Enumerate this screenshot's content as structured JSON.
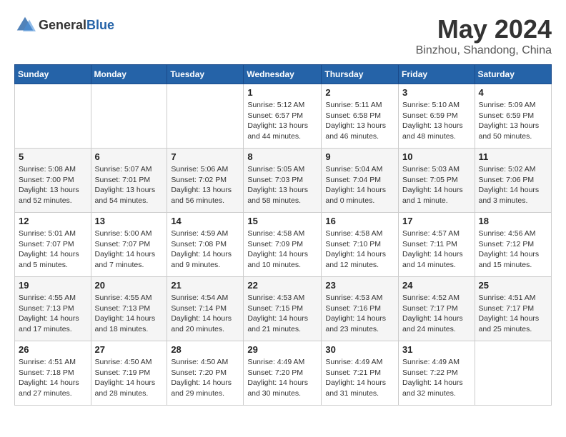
{
  "header": {
    "logo_general": "General",
    "logo_blue": "Blue",
    "month": "May 2024",
    "location": "Binzhou, Shandong, China"
  },
  "days_of_week": [
    "Sunday",
    "Monday",
    "Tuesday",
    "Wednesday",
    "Thursday",
    "Friday",
    "Saturday"
  ],
  "weeks": [
    [
      {
        "day": "",
        "content": ""
      },
      {
        "day": "",
        "content": ""
      },
      {
        "day": "",
        "content": ""
      },
      {
        "day": "1",
        "content": "Sunrise: 5:12 AM\nSunset: 6:57 PM\nDaylight: 13 hours\nand 44 minutes."
      },
      {
        "day": "2",
        "content": "Sunrise: 5:11 AM\nSunset: 6:58 PM\nDaylight: 13 hours\nand 46 minutes."
      },
      {
        "day": "3",
        "content": "Sunrise: 5:10 AM\nSunset: 6:59 PM\nDaylight: 13 hours\nand 48 minutes."
      },
      {
        "day": "4",
        "content": "Sunrise: 5:09 AM\nSunset: 6:59 PM\nDaylight: 13 hours\nand 50 minutes."
      }
    ],
    [
      {
        "day": "5",
        "content": "Sunrise: 5:08 AM\nSunset: 7:00 PM\nDaylight: 13 hours\nand 52 minutes."
      },
      {
        "day": "6",
        "content": "Sunrise: 5:07 AM\nSunset: 7:01 PM\nDaylight: 13 hours\nand 54 minutes."
      },
      {
        "day": "7",
        "content": "Sunrise: 5:06 AM\nSunset: 7:02 PM\nDaylight: 13 hours\nand 56 minutes."
      },
      {
        "day": "8",
        "content": "Sunrise: 5:05 AM\nSunset: 7:03 PM\nDaylight: 13 hours\nand 58 minutes."
      },
      {
        "day": "9",
        "content": "Sunrise: 5:04 AM\nSunset: 7:04 PM\nDaylight: 14 hours\nand 0 minutes."
      },
      {
        "day": "10",
        "content": "Sunrise: 5:03 AM\nSunset: 7:05 PM\nDaylight: 14 hours\nand 1 minute."
      },
      {
        "day": "11",
        "content": "Sunrise: 5:02 AM\nSunset: 7:06 PM\nDaylight: 14 hours\nand 3 minutes."
      }
    ],
    [
      {
        "day": "12",
        "content": "Sunrise: 5:01 AM\nSunset: 7:07 PM\nDaylight: 14 hours\nand 5 minutes."
      },
      {
        "day": "13",
        "content": "Sunrise: 5:00 AM\nSunset: 7:07 PM\nDaylight: 14 hours\nand 7 minutes."
      },
      {
        "day": "14",
        "content": "Sunrise: 4:59 AM\nSunset: 7:08 PM\nDaylight: 14 hours\nand 9 minutes."
      },
      {
        "day": "15",
        "content": "Sunrise: 4:58 AM\nSunset: 7:09 PM\nDaylight: 14 hours\nand 10 minutes."
      },
      {
        "day": "16",
        "content": "Sunrise: 4:58 AM\nSunset: 7:10 PM\nDaylight: 14 hours\nand 12 minutes."
      },
      {
        "day": "17",
        "content": "Sunrise: 4:57 AM\nSunset: 7:11 PM\nDaylight: 14 hours\nand 14 minutes."
      },
      {
        "day": "18",
        "content": "Sunrise: 4:56 AM\nSunset: 7:12 PM\nDaylight: 14 hours\nand 15 minutes."
      }
    ],
    [
      {
        "day": "19",
        "content": "Sunrise: 4:55 AM\nSunset: 7:13 PM\nDaylight: 14 hours\nand 17 minutes."
      },
      {
        "day": "20",
        "content": "Sunrise: 4:55 AM\nSunset: 7:13 PM\nDaylight: 14 hours\nand 18 minutes."
      },
      {
        "day": "21",
        "content": "Sunrise: 4:54 AM\nSunset: 7:14 PM\nDaylight: 14 hours\nand 20 minutes."
      },
      {
        "day": "22",
        "content": "Sunrise: 4:53 AM\nSunset: 7:15 PM\nDaylight: 14 hours\nand 21 minutes."
      },
      {
        "day": "23",
        "content": "Sunrise: 4:53 AM\nSunset: 7:16 PM\nDaylight: 14 hours\nand 23 minutes."
      },
      {
        "day": "24",
        "content": "Sunrise: 4:52 AM\nSunset: 7:17 PM\nDaylight: 14 hours\nand 24 minutes."
      },
      {
        "day": "25",
        "content": "Sunrise: 4:51 AM\nSunset: 7:17 PM\nDaylight: 14 hours\nand 25 minutes."
      }
    ],
    [
      {
        "day": "26",
        "content": "Sunrise: 4:51 AM\nSunset: 7:18 PM\nDaylight: 14 hours\nand 27 minutes."
      },
      {
        "day": "27",
        "content": "Sunrise: 4:50 AM\nSunset: 7:19 PM\nDaylight: 14 hours\nand 28 minutes."
      },
      {
        "day": "28",
        "content": "Sunrise: 4:50 AM\nSunset: 7:20 PM\nDaylight: 14 hours\nand 29 minutes."
      },
      {
        "day": "29",
        "content": "Sunrise: 4:49 AM\nSunset: 7:20 PM\nDaylight: 14 hours\nand 30 minutes."
      },
      {
        "day": "30",
        "content": "Sunrise: 4:49 AM\nSunset: 7:21 PM\nDaylight: 14 hours\nand 31 minutes."
      },
      {
        "day": "31",
        "content": "Sunrise: 4:49 AM\nSunset: 7:22 PM\nDaylight: 14 hours\nand 32 minutes."
      },
      {
        "day": "",
        "content": ""
      }
    ]
  ]
}
